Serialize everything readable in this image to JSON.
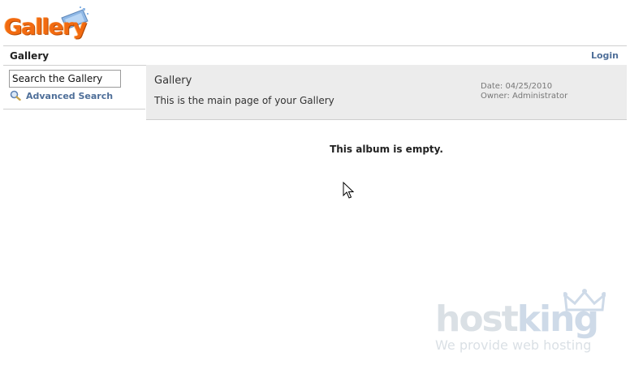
{
  "header": {
    "logo_text": "Gallery"
  },
  "breadcrumb": {
    "current": "Gallery",
    "login_label": "Login"
  },
  "sidebar": {
    "search_value": "Search the Gallery",
    "advanced_search_label": "Advanced Search"
  },
  "album": {
    "title": "Gallery",
    "description": "This is the main page of your Gallery",
    "date": "Date: 04/25/2010",
    "owner": "Owner: Administrator",
    "empty_message": "This album is empty."
  },
  "watermark": {
    "brand_part1": "host",
    "brand_part2": "king",
    "tagline": "We provide web hosting"
  },
  "colors": {
    "logo_orange": "#f26a10",
    "link_blue": "#4f6f99",
    "header_bg": "#ececec"
  }
}
